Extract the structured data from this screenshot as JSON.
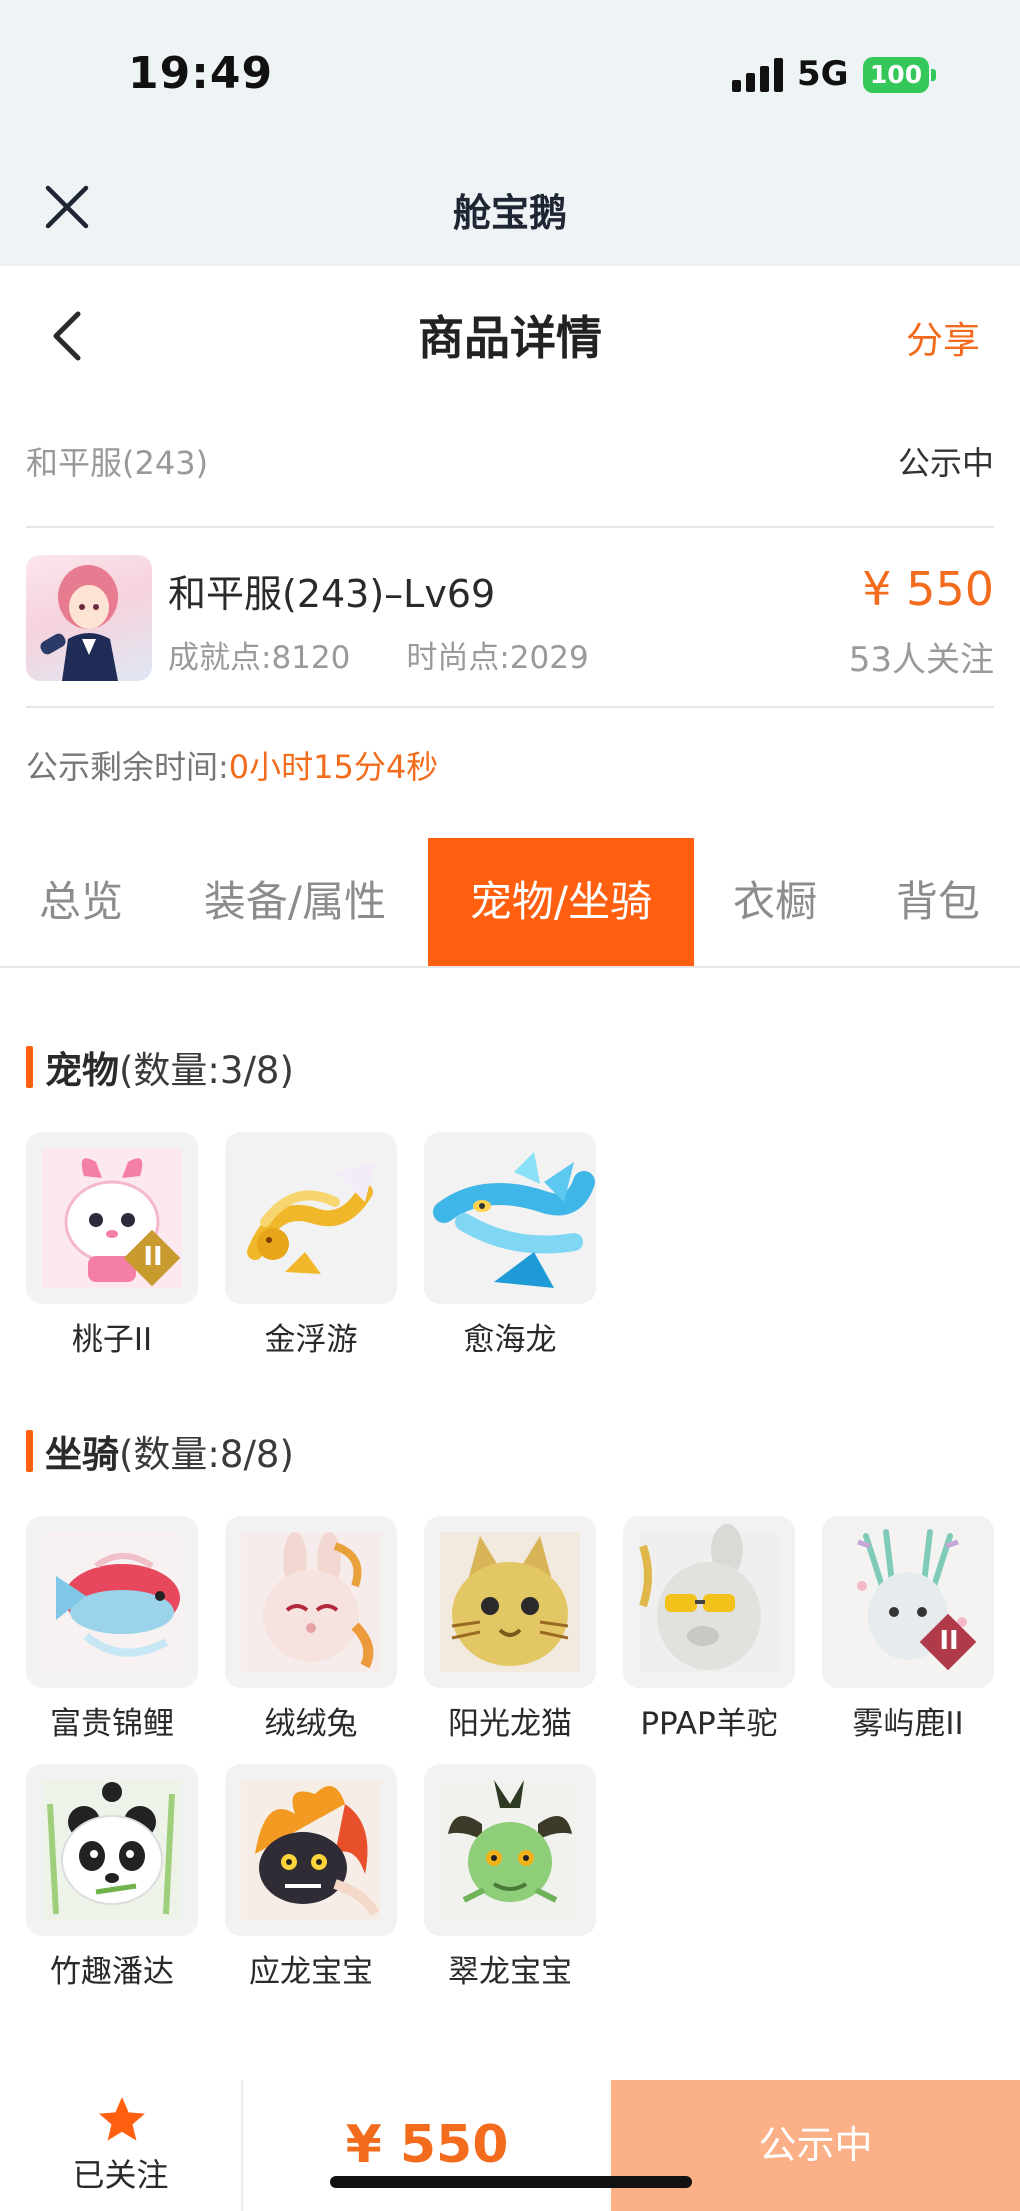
{
  "status_bar": {
    "time": "19:49",
    "network": "5G",
    "battery": "100"
  },
  "app_bar": {
    "title": "舱宝鹅",
    "close_icon": "close-icon"
  },
  "page_header": {
    "title": "商品详情",
    "share": "分享",
    "back_icon": "chevron-left-icon"
  },
  "listing": {
    "server": "和平服(243)",
    "status": "公示中",
    "character_name": "和平服(243)–Lv69",
    "achievement_points": "成就点:8120",
    "fashion_points": "时尚点:2029",
    "price": "¥ 550",
    "followers": "53人关注",
    "countdown_label": "公示剩余时间:",
    "countdown_value": "0小时15分4秒"
  },
  "tabs": [
    {
      "label": "总览",
      "active": false
    },
    {
      "label": "装备/属性",
      "active": false
    },
    {
      "label": "宠物/坐骑",
      "active": true
    },
    {
      "label": "衣橱",
      "active": false
    },
    {
      "label": "背包",
      "active": false
    }
  ],
  "pets": {
    "title": "宠物",
    "count": "(数量:3/8)",
    "items": [
      {
        "name": "桃子II",
        "badge": "II"
      },
      {
        "name": "金浮游"
      },
      {
        "name": "愈海龙"
      }
    ]
  },
  "mounts": {
    "title": "坐骑",
    "count": "(数量:8/8)",
    "items": [
      {
        "name": "富贵锦鲤"
      },
      {
        "name": "绒绒兔"
      },
      {
        "name": "阳光龙猫"
      },
      {
        "name": "PPAP羊驼"
      },
      {
        "name": "雾屿鹿II",
        "badge": "II"
      },
      {
        "name": "竹趣潘达"
      },
      {
        "name": "应龙宝宝"
      },
      {
        "name": "翠龙宝宝"
      }
    ]
  },
  "bottom_bar": {
    "follow_label": "已关注",
    "follow_icon": "star-icon",
    "price": "¥ 550",
    "status_button": "公示中"
  },
  "colors": {
    "accent": "#ff5f0f",
    "price": "#f36b1c",
    "status_button": "#fbb087"
  }
}
